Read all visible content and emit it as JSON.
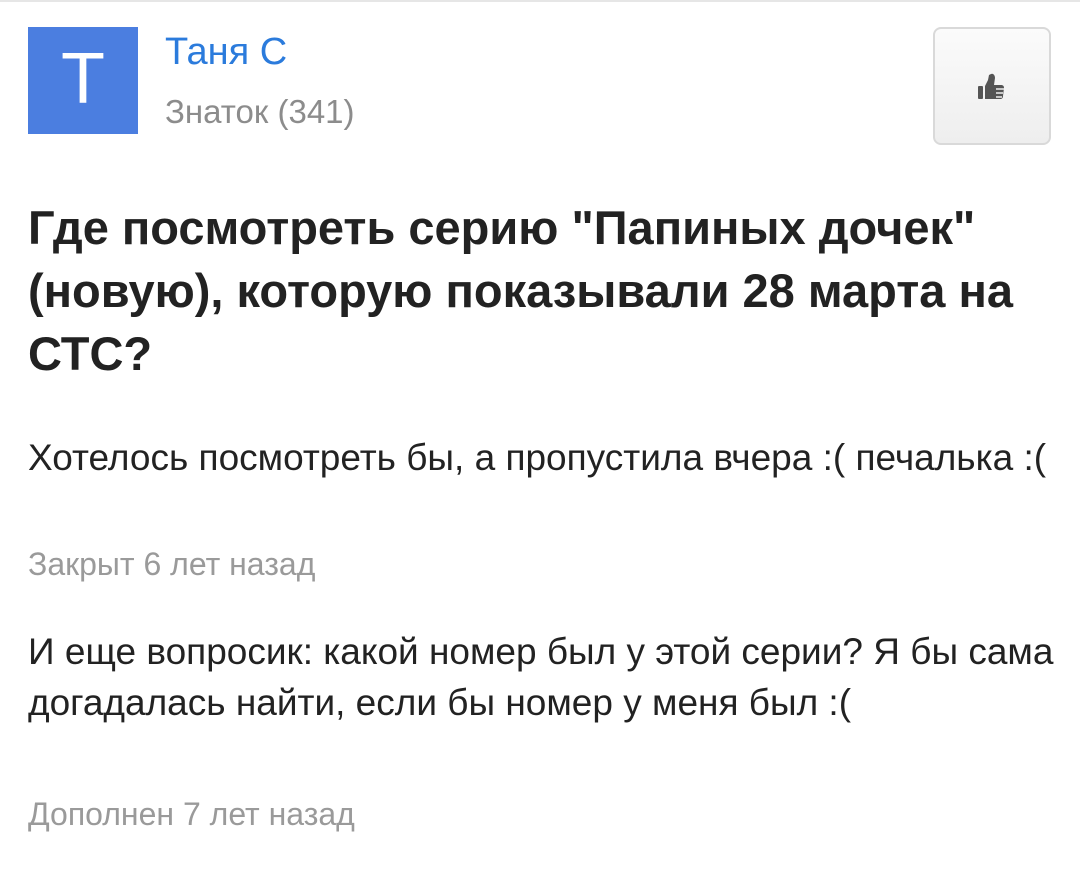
{
  "author": {
    "avatar_letter": "T",
    "name": "Таня С",
    "rank": "Знаток (341)",
    "avatar_color": "#4b7ee0"
  },
  "like_button": {
    "icon": "thumbs-up-icon"
  },
  "question": {
    "title": "Где посмотреть серию \"Папиных дочек\" (новую), которую показывали 28 марта на СТС?",
    "body": "Хотелось посмотреть бы, а пропустила вчера :( печалька :(",
    "status": "Закрыт 6 лет назад"
  },
  "addition": {
    "body": "И еще вопросик: какой номер был у этой серии? Я бы сама догадалась найти, если бы номер у меня был :(",
    "status": "Дополнен 7 лет назад"
  },
  "colors": {
    "accent": "#2b7bdc",
    "muted_text": "#9a9a9a",
    "primary_text": "#222222"
  }
}
